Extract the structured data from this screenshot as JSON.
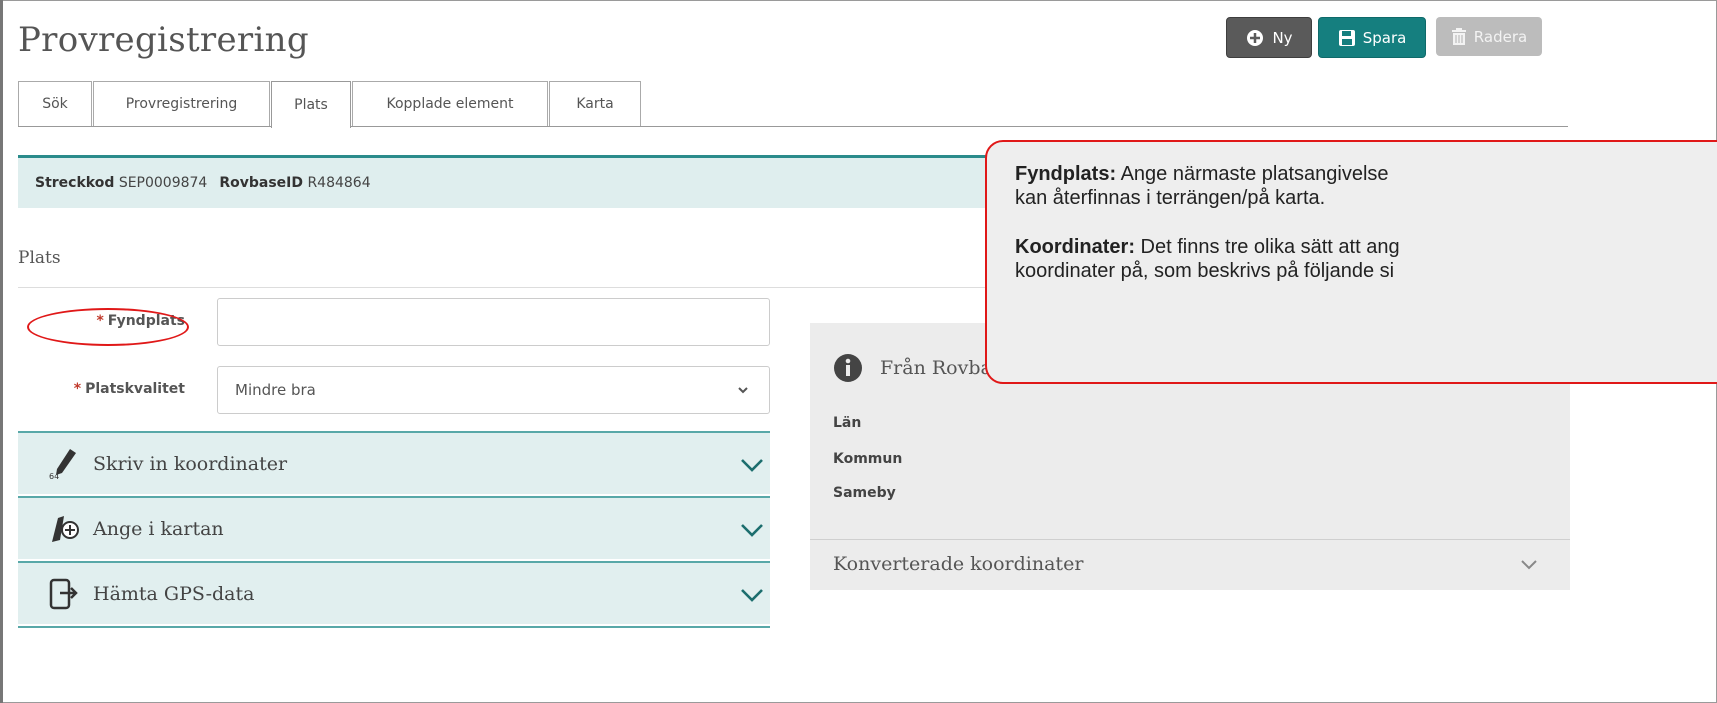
{
  "page": {
    "title": "Provregistrering"
  },
  "toolbar": {
    "new_label": "Ny",
    "save_label": "Spara",
    "delete_label": "Radera"
  },
  "tabs": [
    {
      "label": "Sök",
      "active": false
    },
    {
      "label": "Provregistrering",
      "active": false
    },
    {
      "label": "Plats",
      "active": true
    },
    {
      "label": "Kopplade element",
      "active": false
    },
    {
      "label": "Karta",
      "active": false
    }
  ],
  "idbar": {
    "barcode_label": "Streckkod",
    "barcode_value": "SEP0009874",
    "rovbase_label": "RovbaseID",
    "rovbase_value": "R484864"
  },
  "section": {
    "title": "Plats"
  },
  "form": {
    "required_mark": "*",
    "fyndplats": {
      "label": "Fyndplats",
      "value": ""
    },
    "platskvalitet": {
      "label": "Platskvalitet",
      "selected": "Mindre bra"
    }
  },
  "accordion": [
    {
      "label": "Skriv in koordinater",
      "icon": "pencil-64-icon"
    },
    {
      "label": "Ange i kartan",
      "icon": "map-pin-add-icon"
    },
    {
      "label": "Hämta GPS-data",
      "icon": "phone-import-icon"
    }
  ],
  "info_panel": {
    "heading": "Från Rovbase",
    "fields": [
      "Län",
      "Kommun",
      "Sameby"
    ],
    "converted": "Konverterade koordinater"
  },
  "callout": {
    "line1_bold": "Fyndplats:",
    "line1_text": " Ange närmaste platsangivelse",
    "line2_text": "kan återfinnas i terrängen/på karta.",
    "line3_bold": "Koordinater:",
    "line3_text": " Det finns tre olika sätt att ang",
    "line4_text": "koordinater på, som beskrivs på följande si"
  },
  "colors": {
    "accent": "#157f7f",
    "annotation": "#e01818",
    "accordion_bg": "#e1efef"
  }
}
